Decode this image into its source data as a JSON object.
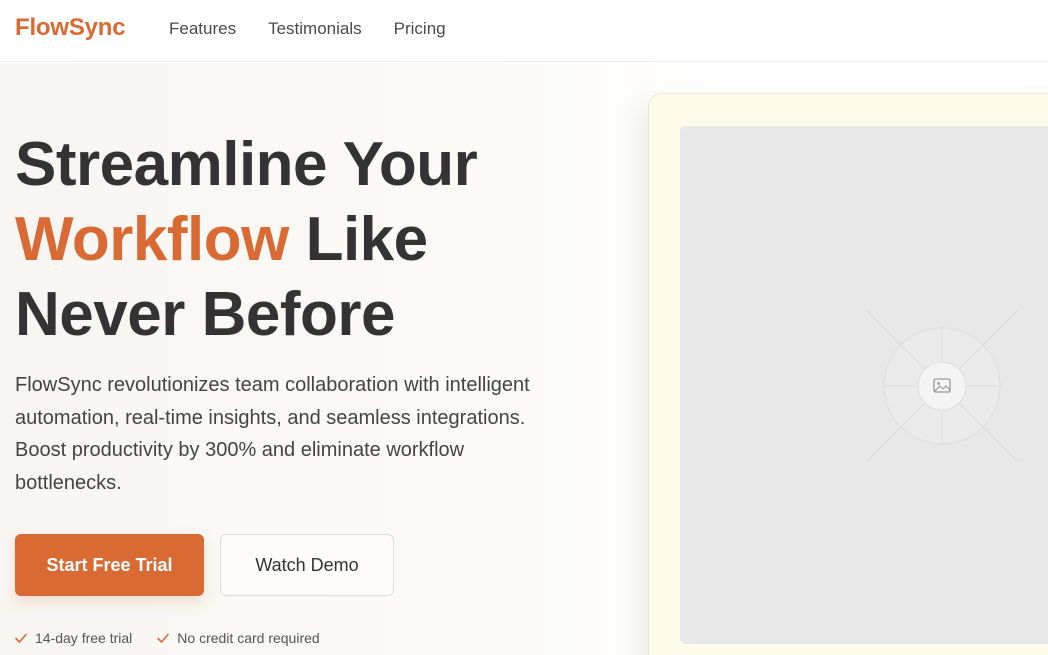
{
  "brand": {
    "name": "FlowSync",
    "accent_color": "#d96a34"
  },
  "nav": {
    "links": [
      "Features",
      "Testimonials",
      "Pricing"
    ]
  },
  "hero": {
    "headline_part1": "Streamline Your",
    "headline_accent": "Workflow",
    "headline_part2": " Like",
    "headline_part3": "Never Before",
    "description": "FlowSync revolutionizes team collaboration with intelligent automation, real-time insights, and seamless integrations. Boost productivity by 300% and eliminate workflow bottlenecks.",
    "primary_cta": "Start Free Trial",
    "secondary_cta": "Watch Demo",
    "features": [
      "14-day free trial",
      "No credit card required"
    ]
  },
  "media": {
    "placeholder_icon": "image-icon",
    "card_bg": "#fffbeb",
    "placeholder_bg": "#e8e8e8"
  }
}
